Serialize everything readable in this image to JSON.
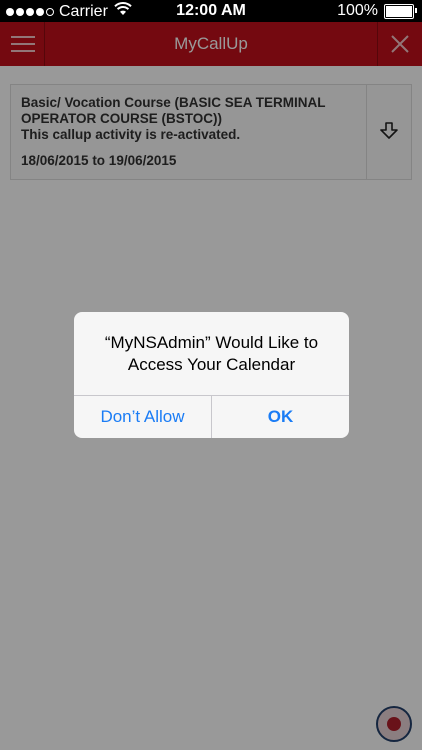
{
  "status_bar": {
    "carrier": "Carrier",
    "time": "12:00 AM",
    "battery": "100%",
    "signal_bars_filled": 4,
    "signal_bars_total": 5
  },
  "navbar": {
    "title": "MyCallUp",
    "background": "#c2101b",
    "menu_icon": "hamburger-menu-icon",
    "close_icon": "close-icon"
  },
  "callup_card": {
    "title_line": "Basic/ Vocation Course (BASIC SEA TERMINAL OPERATOR COURSE (BSTOC))",
    "status_text": "This callup activity is re-activated.",
    "date_range": "18/06/2015 to 19/06/2015",
    "action_icon": "download-arrow-icon"
  },
  "alert": {
    "title": "“MyNSAdmin” Would Like to Access Your Calendar",
    "deny_label": "Don’t Allow",
    "allow_label": "OK",
    "button_color": "#1a7cf5"
  }
}
